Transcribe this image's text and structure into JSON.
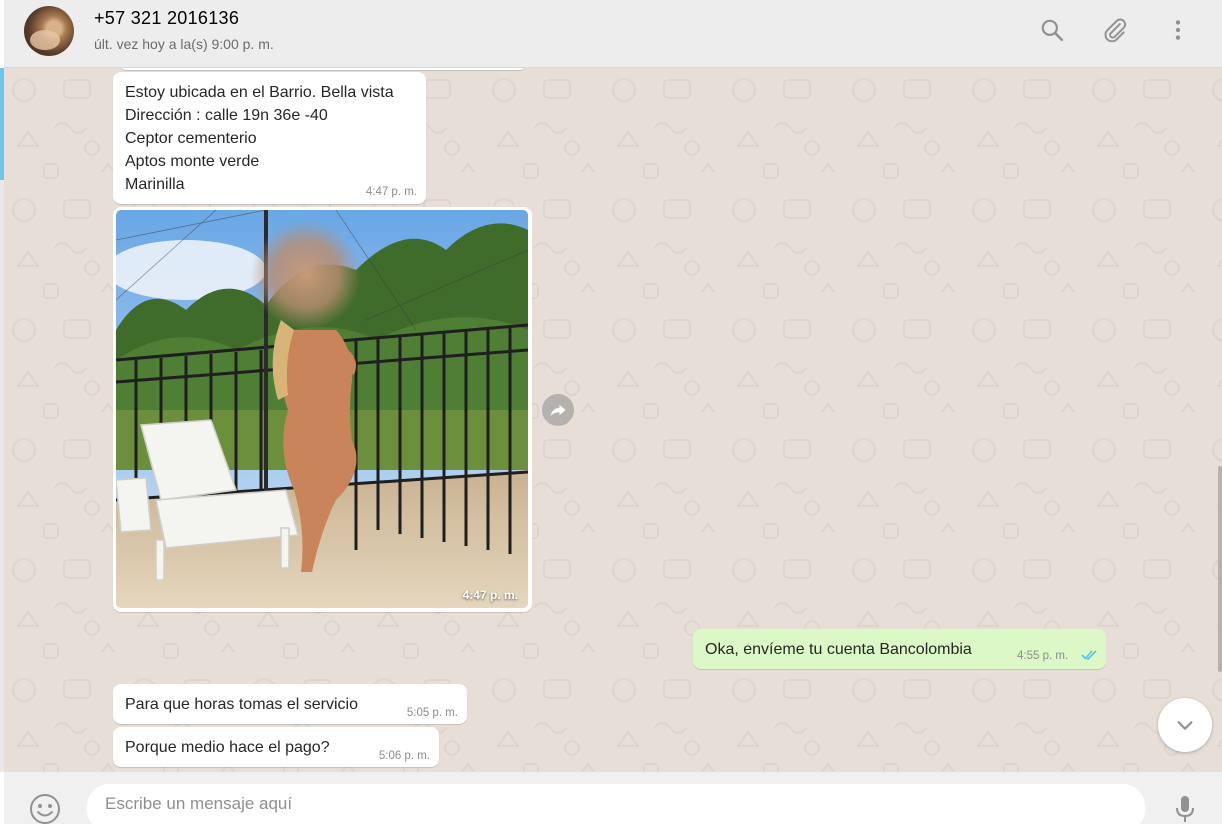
{
  "header": {
    "contact_name": "+57 321 2016136",
    "last_seen": "últ. vez hoy a la(s) 9:00 p. m."
  },
  "messages": [
    {
      "direction": "in",
      "type": "text",
      "text": "Estoy ubicada en el Barrio. Bella vista\nDirección :  calle  19n 36e  -40\nCeptor cementerio\nAptos monte verde\nMarinilla",
      "time": "4:47 p. m."
    },
    {
      "direction": "in",
      "type": "image",
      "time": "4:47 p. m."
    },
    {
      "direction": "out",
      "type": "text",
      "text": "Oka, envíeme tu cuenta Bancolombia",
      "time": "4:55 p. m.",
      "status": "read"
    },
    {
      "direction": "in",
      "type": "text",
      "text": "Para que horas tomas el servicio",
      "time": "5:05 p. m."
    },
    {
      "direction": "in",
      "type": "text",
      "text": "Porque medio hace el pago?",
      "time": "5:06 p. m."
    }
  ],
  "composer": {
    "placeholder": "Escribe un mensaje aquí"
  },
  "colors": {
    "header_bg": "#ededed",
    "chat_bg": "#e6ded7",
    "incoming_bubble": "#ffffff",
    "outgoing_bubble": "#dcf8c6",
    "read_ticks": "#4fc3f7",
    "icon_gray": "#919191"
  },
  "icons": [
    "search-icon",
    "attach-icon",
    "menu-icon",
    "forward-icon",
    "chevron-down-icon",
    "emoji-icon",
    "microphone-icon",
    "double-check-icon"
  ]
}
